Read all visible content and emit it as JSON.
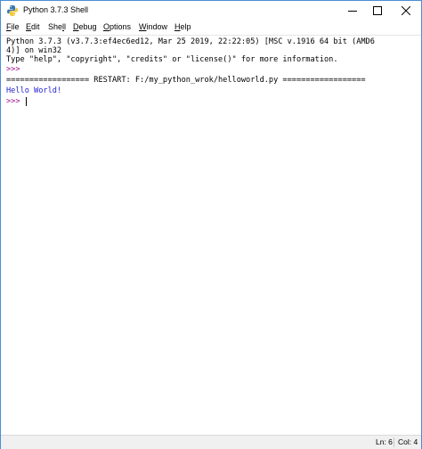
{
  "window": {
    "title": "Python 3.7.3 Shell",
    "buttons": {
      "minimize": "minimize-icon",
      "maximize": "maximize-icon",
      "close": "close-icon"
    }
  },
  "menubar": {
    "items": [
      {
        "pre": "",
        "mnemonic": "F",
        "post": "ile"
      },
      {
        "pre": "",
        "mnemonic": "E",
        "post": "dit"
      },
      {
        "pre": "She",
        "mnemonic": "l",
        "post": "l"
      },
      {
        "pre": "",
        "mnemonic": "D",
        "post": "ebug"
      },
      {
        "pre": "",
        "mnemonic": "O",
        "post": "ptions"
      },
      {
        "pre": "",
        "mnemonic": "W",
        "post": "indow"
      },
      {
        "pre": "",
        "mnemonic": "H",
        "post": "elp"
      }
    ]
  },
  "shell": {
    "lines": [
      "Python 3.7.3 (v3.7.3:ef4ec6ed12, Mar 25 2019, 22:22:05) [MSC v.1916 64 bit (AMD6",
      "4)] on win32",
      "Type \"help\", \"copyright\", \"credits\" or \"license()\" for more information.",
      ">>> ",
      "================== RESTART: F:/my_python_wrok/helloworld.py ==================",
      "Hello World!",
      ">>> "
    ]
  },
  "statusbar": {
    "line": "Ln: 6",
    "col": "Col: 4"
  },
  "colors": {
    "prompt": "#9b0f8f",
    "stdout": "#1f1fd0",
    "border": "#4a8ed6"
  }
}
